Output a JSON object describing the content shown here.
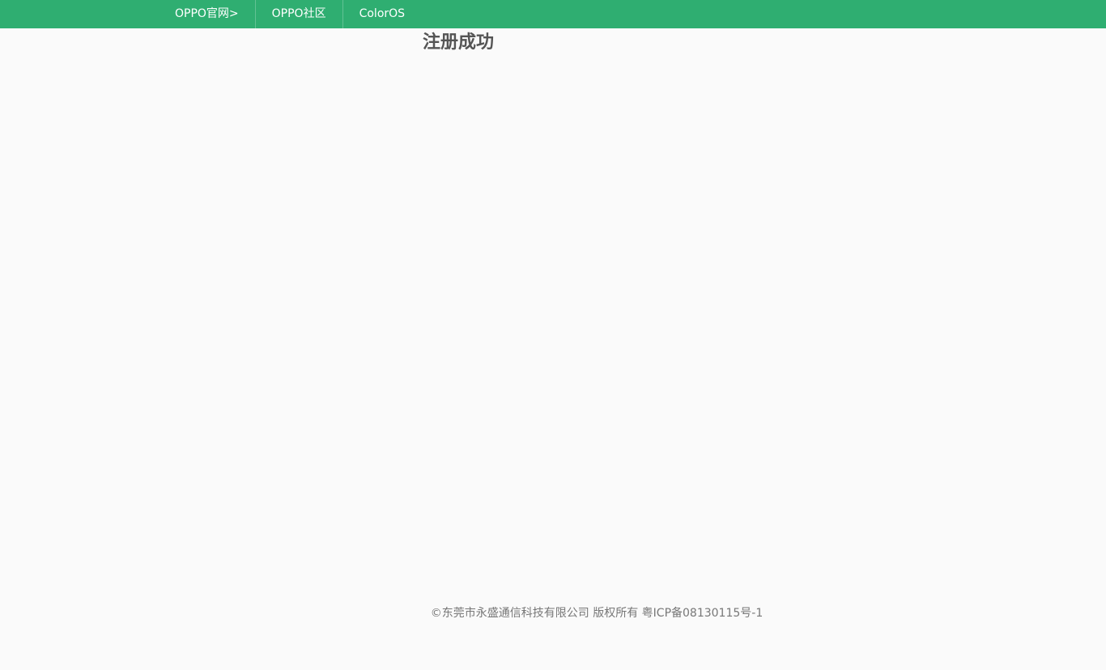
{
  "topbar": {
    "background": "#2fae71",
    "links": [
      {
        "label": "OPPO官网>"
      },
      {
        "label": "OPPO社区"
      },
      {
        "label": "ColorOS"
      }
    ]
  },
  "main": {
    "title": "注册成功"
  },
  "footer": {
    "copyright": "©东莞市永盛通信科技有限公司 版权所有 粤ICP备08130115号-1"
  }
}
